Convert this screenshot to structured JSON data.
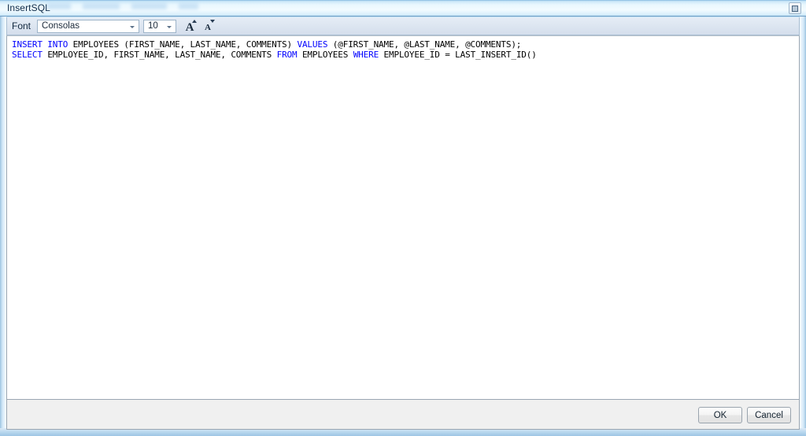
{
  "window": {
    "title": "InsertSQL",
    "restore_button_icon": "restore-window-icon"
  },
  "toolbar": {
    "font_label": "Font",
    "font_family_value": "Consolas",
    "font_size_value": "10",
    "grow_font_icon": "increase-font-size-icon",
    "grow_font_glyph": "A",
    "shrink_font_icon": "decrease-font-size-icon",
    "shrink_font_glyph": "A",
    "dropdown_icon": "chevron-down-icon"
  },
  "editor": {
    "language": "sql",
    "lines": [
      {
        "index": 1,
        "text": "INSERT INTO EMPLOYEES (FIRST_NAME, LAST_NAME, COMMENTS) VALUES (@FIRST_NAME, @LAST_NAME, @COMMENTS);",
        "tokens": [
          {
            "t": "INSERT INTO",
            "k": true
          },
          {
            "t": " EMPLOYEES (FIRST_NAME, LAST_NAME, COMMENTS)",
            "k": false
          },
          {
            "t": " VALUES",
            "k": true
          },
          {
            "t": " (@FIRST_NAME, @LAST_NAME, @COMMENTS);",
            "k": false
          }
        ]
      },
      {
        "index": 2,
        "text": "SELECT EMPLOYEE_ID, FIRST_NAME, LAST_NAME, COMMENTS FROM EMPLOYEES WHERE EMPLOYEE_ID = LAST_INSERT_ID()",
        "tokens": [
          {
            "t": "SELECT",
            "k": true
          },
          {
            "t": " EMPLOYEE_ID, FIRST_NAME, LAST_NAME, COMMENTS ",
            "k": false
          },
          {
            "t": "FROM",
            "k": true
          },
          {
            "t": " EMPLOYEES ",
            "k": false
          },
          {
            "t": "WHERE",
            "k": true
          },
          {
            "t": " EMPLOYEE_ID = LAST_INSERT_ID()",
            "k": false
          }
        ]
      }
    ]
  },
  "footer": {
    "ok_label": "OK",
    "cancel_label": "Cancel"
  },
  "colors": {
    "keyword": "#0000ff",
    "text": "#000000",
    "editor_background": "#ffffff",
    "toolbar_background": "#dde6f1",
    "footer_background": "#f0f0f0",
    "title_text": "#0d2a47"
  }
}
